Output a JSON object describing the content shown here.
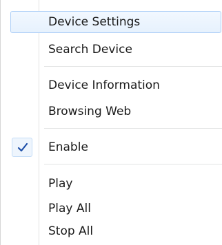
{
  "menu": {
    "items": [
      {
        "label": "Device Settings",
        "highlighted": true
      },
      {
        "label": "Search Device"
      },
      {
        "label": "Device Information"
      },
      {
        "label": "Browsing Web"
      },
      {
        "label": "Enable",
        "checked": true
      },
      {
        "label": "Play"
      },
      {
        "label": "Play All"
      },
      {
        "label": "Stop All"
      }
    ],
    "check_icon": "checkmark-icon",
    "colors": {
      "highlight_border": "#aecff7",
      "highlight_bg": "#e6f1fd",
      "check": "#1e4fa8",
      "separator": "#e2e3e3"
    }
  }
}
